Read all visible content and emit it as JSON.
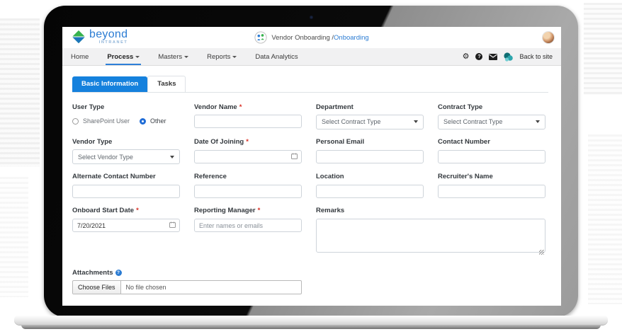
{
  "header": {
    "logo": {
      "brand": "beyond",
      "sub": "INTRANET"
    },
    "title_prefix": "Vendor Onboarding /",
    "title_link": "Onboarding"
  },
  "nav": {
    "items": [
      {
        "label": "Home",
        "dropdown": false,
        "active": false
      },
      {
        "label": "Process",
        "dropdown": true,
        "active": true
      },
      {
        "label": "Masters",
        "dropdown": true,
        "active": false
      },
      {
        "label": "Reports",
        "dropdown": true,
        "active": false
      },
      {
        "label": "Data Analytics",
        "dropdown": false,
        "active": false
      }
    ],
    "icons": [
      "gear-icon",
      "help-icon",
      "mail-icon",
      "sharepoint-icon"
    ],
    "back_to_site": "Back to site"
  },
  "tabs": [
    {
      "label": "Basic Information",
      "active": true
    },
    {
      "label": "Tasks",
      "active": false
    }
  ],
  "form": {
    "user_type": {
      "label": "User Type",
      "options": [
        {
          "label": "SharePoint User",
          "selected": false
        },
        {
          "label": "Other",
          "selected": true
        }
      ]
    },
    "vendor_name": {
      "label": "Vendor Name",
      "required": "*",
      "value": ""
    },
    "department": {
      "label": "Department",
      "value": "Select Contract Type"
    },
    "contract_type": {
      "label": "Contract Type",
      "value": "Select Contract Type"
    },
    "vendor_type": {
      "label": "Vendor Type",
      "value": "Select Vendor Type"
    },
    "date_of_joining": {
      "label": "Date Of Joining",
      "required": "*",
      "value": ""
    },
    "personal_email": {
      "label": "Personal Email",
      "value": ""
    },
    "contact_number": {
      "label": "Contact Number",
      "value": ""
    },
    "alternate_contact_number": {
      "label": "Alternate Contact Number",
      "value": ""
    },
    "reference": {
      "label": "Reference",
      "value": ""
    },
    "location": {
      "label": "Location",
      "value": ""
    },
    "recruiters_name": {
      "label": "Recruiter's Name",
      "value": ""
    },
    "onboard_start_date": {
      "label": "Onboard Start Date",
      "required": "*",
      "value": "7/20/2021"
    },
    "reporting_manager": {
      "label": "Reporting Manager",
      "required": "*",
      "value": "",
      "placeholder": "Enter names or emails"
    },
    "remarks": {
      "label": "Remarks",
      "value": ""
    },
    "attachments": {
      "label": "Attachments",
      "button": "Choose Files",
      "status": "No file chosen"
    }
  },
  "colors": {
    "accent": "#1581dd",
    "link": "#2b7cd3",
    "required": "#d93025",
    "nav_underline": "#2d7fd8",
    "sharepoint_teal": "#128387"
  }
}
